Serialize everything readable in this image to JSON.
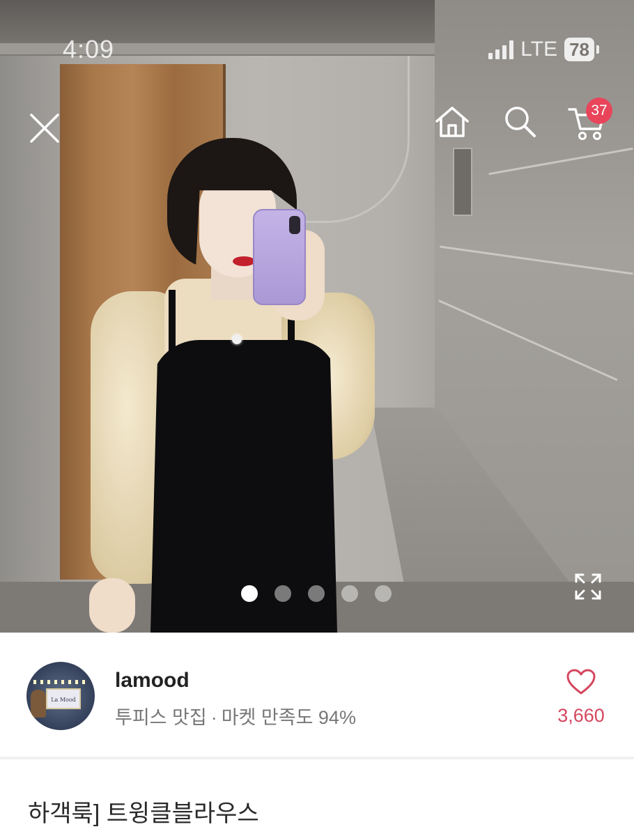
{
  "status_bar": {
    "time": "4:09",
    "network": "LTE",
    "battery": "78"
  },
  "top_nav": {
    "icons": [
      "close-icon",
      "home-icon",
      "search-icon",
      "cart-icon"
    ],
    "cart_badge": "37"
  },
  "gallery": {
    "total_images": 5,
    "active_index": 0,
    "expand_icon": "expand-icon"
  },
  "seller": {
    "avatar_sign": "La Mood",
    "name": "lamood",
    "category": "투피스 맛집",
    "separator": "·",
    "satisfaction": "마켓 만족도 94%",
    "likes": "3,660",
    "like_icon": "heart-icon"
  },
  "product": {
    "title": "하객룩] 트윙클블라우스"
  },
  "colors": {
    "accent_pink": "#e8455a",
    "like_pink": "#d4475f",
    "text_dark": "#222222",
    "text_muted": "#777777"
  }
}
